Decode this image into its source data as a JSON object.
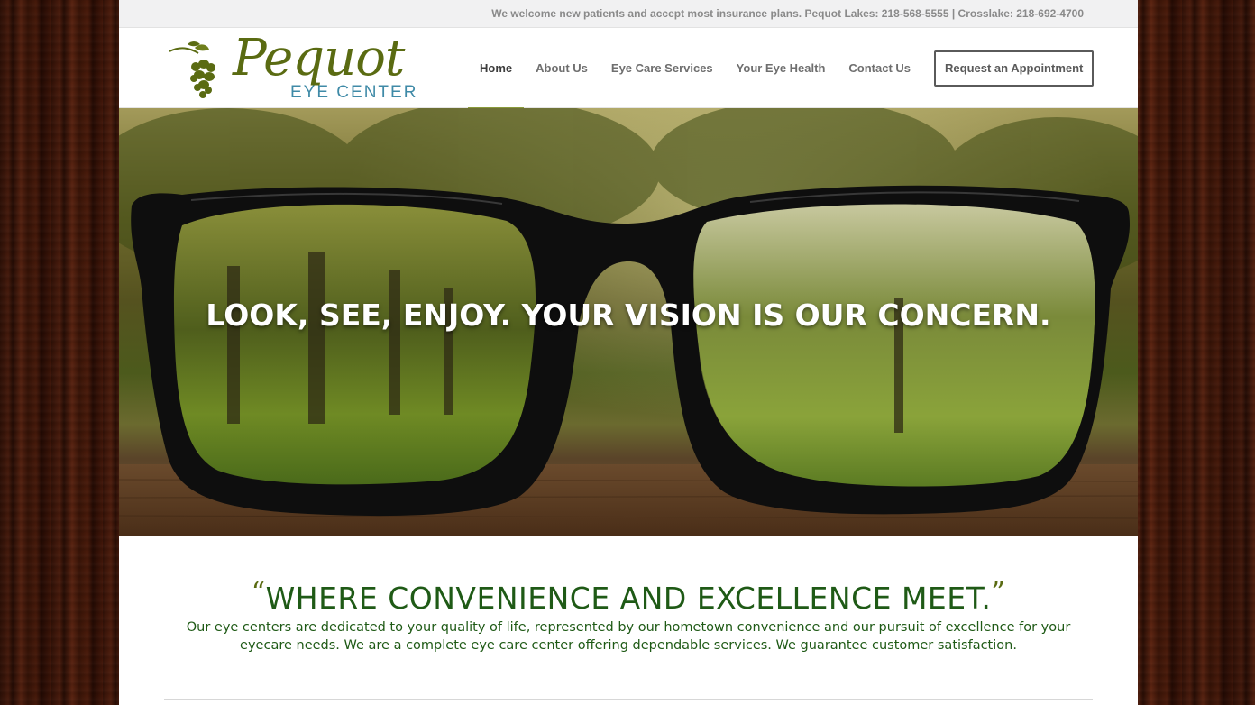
{
  "topbar": {
    "notice": "We welcome new patients and accept most insurance plans. Pequot Lakes: 218-568-5555 | Crosslake: 218-692-4700"
  },
  "logo": {
    "script_text": "Pequot",
    "sub_text": "EYE CENTER",
    "icon": "pinecone-icon"
  },
  "nav": {
    "items": [
      {
        "label": "Home",
        "active": true
      },
      {
        "label": "About Us",
        "active": false
      },
      {
        "label": "Eye Care Services",
        "active": false
      },
      {
        "label": "Your Eye Health",
        "active": false
      },
      {
        "label": "Contact Us",
        "active": false
      }
    ],
    "cta_label": "Request an Appointment"
  },
  "hero": {
    "headline": "LOOK, SEE, ENJOY. YOUR VISION IS OUR CONCERN."
  },
  "intro": {
    "open_quote": "“",
    "heading": "WHERE CONVENIENCE AND EXCELLENCE MEET.",
    "close_quote": "”",
    "body": "Our eye centers are dedicated to your quality of life, represented by our hometown convenience and our pursuit of excellence for your eyecare needs. We are a complete eye care center offering dependable services. We guarantee customer satisfaction."
  },
  "colors": {
    "brand_green": "#5a6b12",
    "text_green": "#1f5a16",
    "accent_blue": "#3f8aa7",
    "nav_underline": "#8a9a3c"
  }
}
